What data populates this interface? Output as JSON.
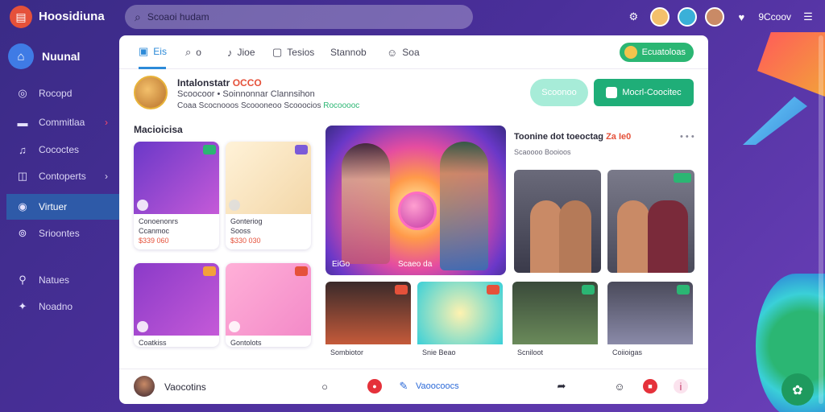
{
  "app": {
    "title": "Hoosidiuna",
    "logo_icon": "app-logo-icon"
  },
  "search": {
    "placeholder": "Scoaoi hudam"
  },
  "topbar": {
    "user_label": "9Ccoov",
    "icons": [
      "gear-icon",
      "bell-icon",
      "chat-icon",
      "menu-icon"
    ]
  },
  "sidebar": {
    "header": "Nuunal",
    "items": [
      {
        "label": "Rocopd",
        "icon": "at-icon",
        "chevron": false,
        "active": false
      },
      {
        "label": "Commitlaa",
        "icon": "folder-icon",
        "chevron": true,
        "active": false
      },
      {
        "label": "Cococtes",
        "icon": "music-icon",
        "chevron": false,
        "active": false
      },
      {
        "label": "Contoperts",
        "icon": "layers-icon",
        "chevron": true,
        "active": false
      },
      {
        "label": "Virtuer",
        "icon": "eye-icon",
        "chevron": false,
        "active": true
      },
      {
        "label": "Srioontes",
        "icon": "target-icon",
        "chevron": false,
        "active": false
      },
      {
        "label": "Natues",
        "icon": "link-icon",
        "chevron": false,
        "active": false
      },
      {
        "label": "Noadno",
        "icon": "star-icon",
        "chevron": false,
        "active": false
      }
    ]
  },
  "tabs": [
    {
      "label": "Eis",
      "icon": "grid-icon",
      "active": true
    },
    {
      "label": "o",
      "icon": "search-icon",
      "active": false
    },
    {
      "label": "Jioe",
      "icon": "music-icon",
      "active": false
    },
    {
      "label": "Tesios",
      "icon": "box-icon",
      "active": false
    },
    {
      "label": "Stannob",
      "icon": "",
      "active": false
    },
    {
      "label": "Soa",
      "icon": "face-icon",
      "active": false
    }
  ],
  "header_pill": {
    "label": "Ecuatoloas"
  },
  "profile": {
    "name": "Intalonstatr",
    "name_highlight": "OCCO",
    "sub": "Scoocoor • Soinnonnar Clannsihon",
    "meta": "Coaa Scocnooos Scoooneoo Scooocios",
    "meta_tag": "Rocooooc"
  },
  "actions": {
    "light_button": "Scoonoo",
    "green_button": "Mocrl-Coocitec"
  },
  "section_title": "Macioicisa",
  "small_cards": [
    {
      "title": "Conoenonrs",
      "sub": "Ccanmoc",
      "price": "$339 060",
      "badge_color": "#2bb673"
    },
    {
      "title": "Gonteriog",
      "sub": "Sooss",
      "price": "$330 030",
      "badge_color": "#7b5ad8"
    },
    {
      "title": "Coatkiss",
      "sub": "",
      "price": "",
      "badge_color": "#f3a13a"
    },
    {
      "title": "Gontolots",
      "sub": "",
      "price": "",
      "badge_color": "#e5513a"
    }
  ],
  "feature": {
    "caption_left": "EiGo",
    "caption_right": "Scaeo da"
  },
  "right_panel": {
    "title": "Toonine dot toeoctag",
    "title_accent": "Za Ie0",
    "sub": "Scaoooo Booioos",
    "dots": "• • •"
  },
  "bottom_cards": [
    {
      "label": "Sombiotor",
      "badge_color": "#e5513a"
    },
    {
      "label": "Snie Beao",
      "badge_color": "#e5513a"
    },
    {
      "label": "Scniloot",
      "badge_color": "#2bb673"
    },
    {
      "label": "Coiioigas",
      "badge_color": "#2bb673"
    }
  ],
  "bottombar": {
    "user": "Vaocotins",
    "middle_label": "Vaoocoocs"
  },
  "colors": {
    "accent_green": "#2bb673",
    "accent_blue": "#2c8ad8",
    "accent_red": "#e5513a",
    "bg_purple": "#3a2b86"
  }
}
